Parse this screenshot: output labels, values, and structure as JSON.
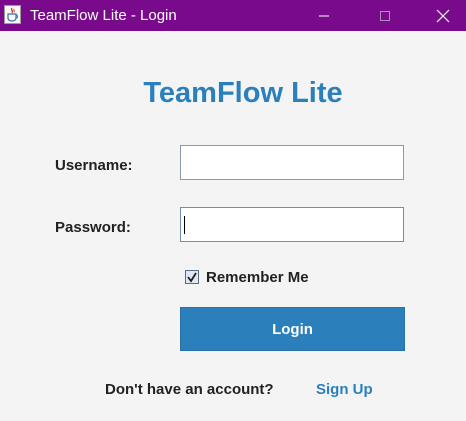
{
  "window": {
    "title": "TeamFlow Lite - Login",
    "icon": "java-cup-icon",
    "controls": [
      "minimize-icon",
      "maximize-icon",
      "close-icon"
    ],
    "titlebar_color": "#7a0a8c"
  },
  "login": {
    "app_title": "TeamFlow Lite",
    "username_label": "Username:",
    "username_value": "",
    "password_label": "Password:",
    "password_value": "",
    "password_focused": true,
    "remember_label": "Remember Me",
    "remember_checked": true,
    "login_button": "Login",
    "no_account_text": "Don't have an account?",
    "signup_link": "Sign Up"
  },
  "colors": {
    "accent": "#2b80bc",
    "title": "#2b7fbb",
    "background": "#f4f4f4"
  }
}
